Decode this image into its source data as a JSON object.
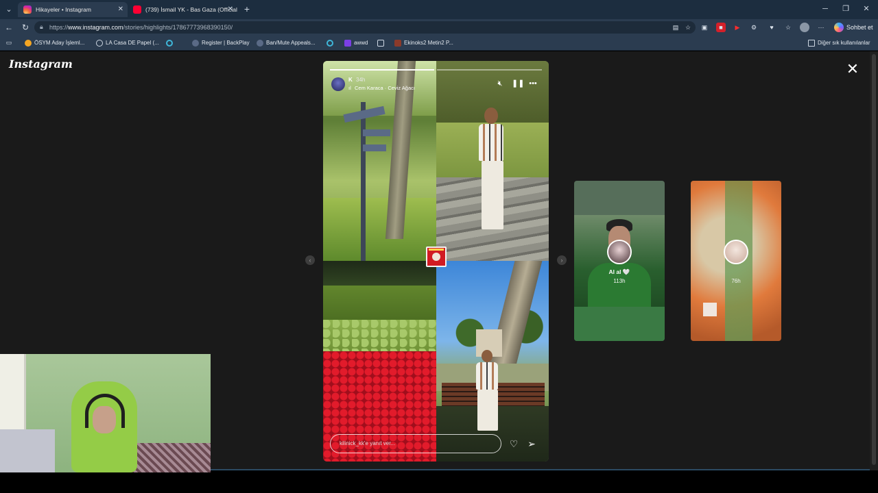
{
  "tabs": [
    {
      "title": "Hikayeler • Instagram",
      "active": true,
      "favicon_color": "#d6249f"
    },
    {
      "title": "(739) İsmail YK - Bas Gaza (Official",
      "active": false,
      "favicon_color": "#ff0033"
    }
  ],
  "window_controls": {
    "minimize": "─",
    "restore": "❐",
    "close": "✕"
  },
  "address_bar": {
    "url_prefix": "https://",
    "url_host": "www.instagram.com",
    "url_path": "/stories/highlights/17867773968390150/"
  },
  "chat_button": {
    "label": "Sohbet et"
  },
  "bookmarks": [
    {
      "label": "ÖSYM Aday İşleml...",
      "icon_color": "#f5a623"
    },
    {
      "label": "LA Casa DE Papel (...",
      "icon_color": "#cfd8e3"
    },
    {
      "label": "",
      "icon_color": "#3fb7d9"
    },
    {
      "label": "Register | BackPlay",
      "icon_color": "#cfd8e3"
    },
    {
      "label": "Ban/Mute Appeals...",
      "icon_color": "#cfd8e3"
    },
    {
      "label": "",
      "icon_color": "#3fb7d9"
    },
    {
      "label": "awwd",
      "icon_color": "#7b3fe4"
    },
    {
      "label": "",
      "icon_color": "#cfd8e3"
    },
    {
      "label": "Ekinoks2 Metin2 P...",
      "icon_color": "#8b3a2a"
    }
  ],
  "other_bookmarks": {
    "label": "Diğer sık kullanılanlar"
  },
  "instagram": {
    "logo": "Instagram",
    "close_icon": "close-icon"
  },
  "story": {
    "username": "K",
    "time": "34h",
    "song": "Cem Karaca · Ceviz Ağacı",
    "reply_placeholder": "kilinick_kk'e yanıt ver...",
    "progress_segments": 2,
    "progress_current": 1
  },
  "previews": [
    {
      "name": "Al al 🤍",
      "time": "113h"
    },
    {
      "name": "",
      "time": "76h"
    }
  ],
  "colors": {
    "page_bg": "#1a1a1a",
    "chrome_bg": "#2b3c50",
    "tabbar_bg": "#1c2d3f"
  }
}
